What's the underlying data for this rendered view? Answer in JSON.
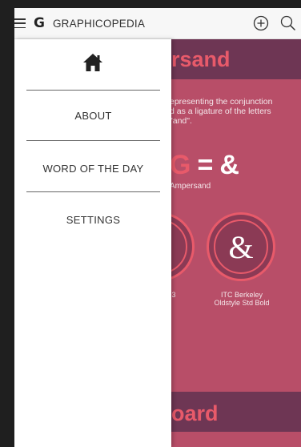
{
  "app": {
    "logo": "G",
    "title": "GRAPHICOPEDIA"
  },
  "drawer": {
    "items": [
      {
        "label": "ABOUT"
      },
      {
        "label": "WORD OF THE DAY"
      },
      {
        "label": "SETTINGS"
      }
    ]
  },
  "content": {
    "title_visible": "rsand",
    "description_visible": "epresenting the conjunction\nd as a ligature of the letters\n\"and\".",
    "formula_left": "G",
    "formula_equals": "=",
    "formula_right": "&",
    "formula_caption_visible": "Ampersand",
    "examples": [
      {
        "glyph": "",
        "caption_visible": ".3"
      },
      {
        "glyph": "&",
        "caption": "ITC Berkeley\nOldstyle Std Bold"
      }
    ],
    "lower_title_visible": "oard"
  },
  "colors": {
    "band": "#6e3654",
    "accent": "#e85a6a",
    "background": "#b84e68"
  },
  "icons": [
    "menu-icon",
    "add-icon",
    "search-icon",
    "home-icon"
  ]
}
